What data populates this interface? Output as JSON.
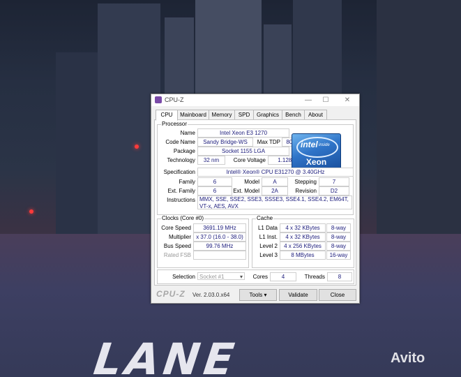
{
  "window": {
    "title": "CPU-Z",
    "minimize": "—",
    "maximize": "☐",
    "close": "✕"
  },
  "tabs": [
    "CPU",
    "Mainboard",
    "Memory",
    "SPD",
    "Graphics",
    "Bench",
    "About"
  ],
  "processor": {
    "legend": "Processor",
    "name_label": "Name",
    "name": "Intel Xeon E3 1270",
    "codename_label": "Code Name",
    "codename": "Sandy Bridge-WS",
    "maxtdp_label": "Max TDP",
    "maxtdp": "80.0 W",
    "package_label": "Package",
    "package": "Socket 1155 LGA",
    "technology_label": "Technology",
    "technology": "32 nm",
    "corevoltage_label": "Core Voltage",
    "corevoltage": "1.128 V",
    "specification_label": "Specification",
    "specification": "Intel® Xeon® CPU E31270 @ 3.40GHz",
    "family_label": "Family",
    "family": "6",
    "model_label": "Model",
    "model": "A",
    "stepping_label": "Stepping",
    "stepping": "7",
    "extfamily_label": "Ext. Family",
    "extfamily": "6",
    "extmodel_label": "Ext. Model",
    "extmodel": "2A",
    "revision_label": "Revision",
    "revision": "D2",
    "instructions_label": "Instructions",
    "instructions": "MMX, SSE, SSE2, SSE3, SSSE3, SSE4.1, SSE4.2, EM64T, VT-x, AES, AVX",
    "logo": {
      "brand": "intel",
      "inside": "inside",
      "line": "Xeon"
    }
  },
  "clocks": {
    "legend": "Clocks (Core #0)",
    "corespeed_label": "Core Speed",
    "corespeed": "3691.19 MHz",
    "multiplier_label": "Multiplier",
    "multiplier": "x 37.0 (16.0 - 38.0)",
    "busspeed_label": "Bus Speed",
    "busspeed": "99.76 MHz",
    "ratedfsb_label": "Rated FSB",
    "ratedfsb": ""
  },
  "cache": {
    "legend": "Cache",
    "rows": [
      {
        "label": "L1 Data",
        "size": "4 x 32 KBytes",
        "ways": "8-way"
      },
      {
        "label": "L1 Inst.",
        "size": "4 x 32 KBytes",
        "ways": "8-way"
      },
      {
        "label": "Level 2",
        "size": "4 x 256 KBytes",
        "ways": "8-way"
      },
      {
        "label": "Level 3",
        "size": "8 MBytes",
        "ways": "16-way"
      }
    ]
  },
  "selection": {
    "label": "Selection",
    "socket": "Socket #1",
    "cores_label": "Cores",
    "cores": "4",
    "threads_label": "Threads",
    "threads": "8"
  },
  "footer": {
    "brand": "CPU-Z",
    "version": "Ver. 2.03.0.x64",
    "tools": "Tools",
    "validate": "Validate",
    "close": "Close"
  },
  "background": {
    "street_text": "LANE",
    "watermark": "Avito"
  }
}
